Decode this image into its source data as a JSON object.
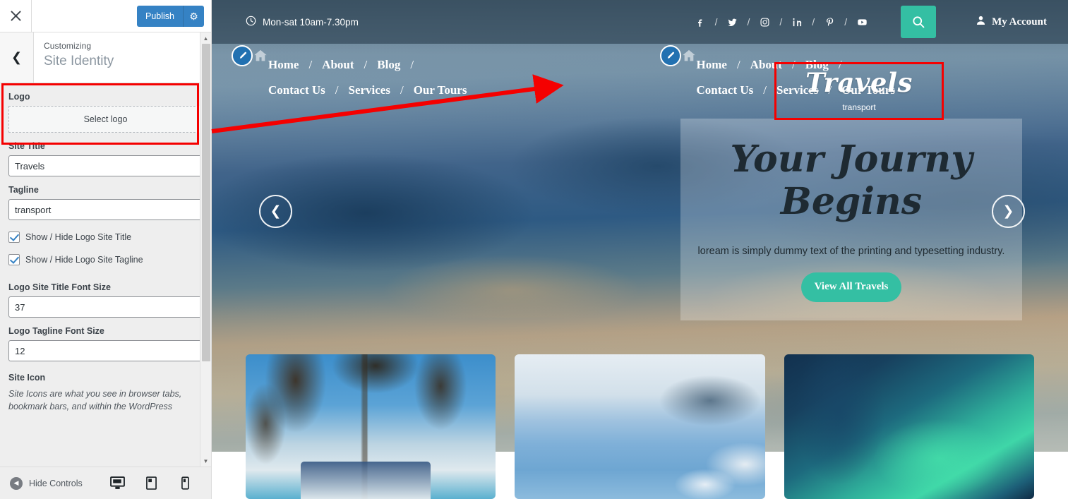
{
  "customizer": {
    "close_label": "Close",
    "publish_label": "Publish",
    "gear_label": "Publish settings",
    "breadcrumb": "Customizing",
    "panel_title": "Site Identity",
    "back_label": "Back",
    "controls": {
      "logo_label": "Logo",
      "select_logo_label": "Select logo",
      "site_title_label": "Site Title",
      "site_title_value": "Travels",
      "tagline_label": "Tagline",
      "tagline_value": "transport",
      "show_hide_title_label": "Show / Hide Logo Site Title",
      "show_hide_tagline_label": "Show / Hide Logo Site Tagline",
      "title_font_size_label": "Logo Site Title Font Size",
      "title_font_size_value": "37",
      "tagline_font_size_label": "Logo Tagline Font Size",
      "tagline_font_size_value": "12",
      "site_icon_label": "Site Icon",
      "site_icon_desc": "Site Icons are what you see in browser tabs, bookmark bars, and within the WordPress"
    },
    "footer": {
      "hide_controls_label": "Hide Controls",
      "device_desktop": "Desktop",
      "device_tablet": "Tablet",
      "device_mobile": "Mobile"
    },
    "accent_color": "#3582c4",
    "highlight_color": "#f50000"
  },
  "preview": {
    "topbar": {
      "hours": "Mon-sat 10am-7.30pm",
      "socials": [
        "facebook",
        "twitter",
        "instagram",
        "linkedin",
        "pinterest",
        "youtube"
      ],
      "search_label": "Search",
      "account_label": "My Account"
    },
    "nav": {
      "items_row1": [
        "Home",
        "About",
        "Blog",
        "Contact Us"
      ],
      "items_row2": [
        "Services",
        "Our Tours"
      ],
      "separator": "/"
    },
    "logo": {
      "title": "Travels",
      "tagline": "transport"
    },
    "hero": {
      "heading_line1": "Your Journy",
      "heading_line2": "Begins",
      "paragraph": "loream is simply dummy text of the printing and typesetting industry.",
      "button_label": "View All Travels",
      "prev_label": "Previous slide",
      "next_label": "Next slide"
    },
    "cards": [
      {
        "name": "palm-beach-card"
      },
      {
        "name": "coastal-village-card"
      },
      {
        "name": "aurora-card"
      }
    ],
    "accent_color": "#34bfa3"
  }
}
